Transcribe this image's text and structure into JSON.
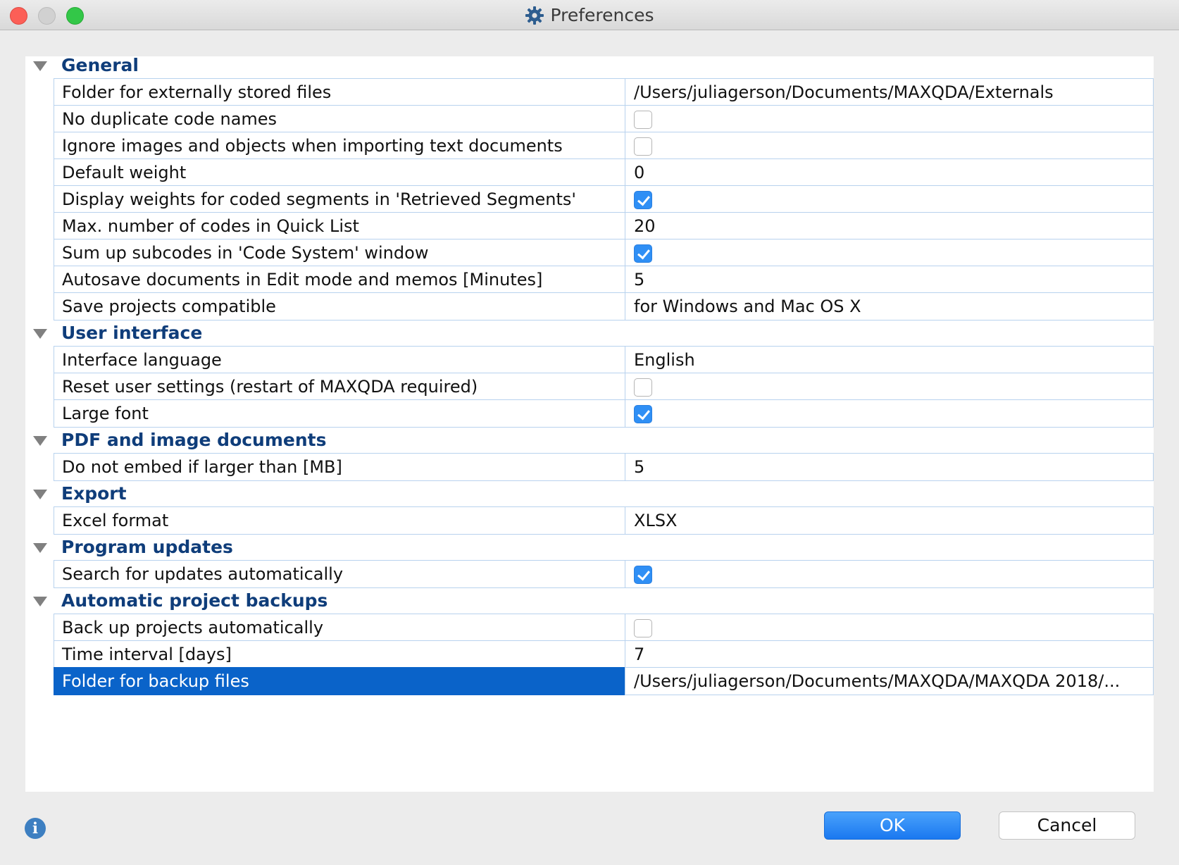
{
  "window": {
    "title": "Preferences",
    "title_icon": "gear-icon"
  },
  "sections": [
    {
      "label": "General",
      "expanded": true,
      "items": [
        {
          "name": "Folder for externally stored files",
          "type": "text",
          "value": "/Users/juliagerson/Documents/MAXQDA/Externals"
        },
        {
          "name": "No duplicate code names",
          "type": "checkbox",
          "checked": false
        },
        {
          "name": "Ignore images and objects when importing text documents",
          "type": "checkbox",
          "checked": false
        },
        {
          "name": "Default weight",
          "type": "text",
          "value": "0"
        },
        {
          "name": "Display weights for coded segments in 'Retrieved Segments'",
          "type": "checkbox",
          "checked": true
        },
        {
          "name": "Max. number of codes in Quick List",
          "type": "text",
          "value": "20"
        },
        {
          "name": "Sum up subcodes in 'Code System' window",
          "type": "checkbox",
          "checked": true
        },
        {
          "name": "Autosave documents in Edit mode and memos [Minutes]",
          "type": "text",
          "value": "5"
        },
        {
          "name": "Save projects compatible",
          "type": "text",
          "value": "for Windows and Mac OS X"
        }
      ]
    },
    {
      "label": "User interface",
      "expanded": true,
      "items": [
        {
          "name": "Interface language",
          "type": "text",
          "value": "English"
        },
        {
          "name": "Reset user settings (restart of MAXQDA required)",
          "type": "checkbox",
          "checked": false
        },
        {
          "name": "Large font",
          "type": "checkbox",
          "checked": true
        }
      ]
    },
    {
      "label": "PDF and image documents",
      "expanded": true,
      "items": [
        {
          "name": "Do not embed if larger than [MB]",
          "type": "text",
          "value": "5"
        }
      ]
    },
    {
      "label": "Export",
      "expanded": true,
      "items": [
        {
          "name": "Excel format",
          "type": "text",
          "value": "XLSX"
        }
      ]
    },
    {
      "label": "Program updates",
      "expanded": true,
      "items": [
        {
          "name": "Search for updates automatically",
          "type": "checkbox",
          "checked": true
        }
      ]
    },
    {
      "label": "Automatic project backups",
      "expanded": true,
      "items": [
        {
          "name": "Back up projects automatically",
          "type": "checkbox",
          "checked": false
        },
        {
          "name": "Time interval [days]",
          "type": "text",
          "value": "7"
        },
        {
          "name": "Folder for backup files",
          "type": "text",
          "value": "/Users/juliagerson/Documents/MAXQDA/MAXQDA 2018/...",
          "selected": true
        }
      ]
    }
  ],
  "footer": {
    "info_icon": "info-icon",
    "ok_label": "OK",
    "cancel_label": "Cancel"
  },
  "colors": {
    "section_heading": "#0f3d7a",
    "selection": "#0a63c9",
    "checkbox_checked": "#2f8ff5",
    "grid_line": "#b8d2ee",
    "ok_button": "#1a78f0"
  }
}
